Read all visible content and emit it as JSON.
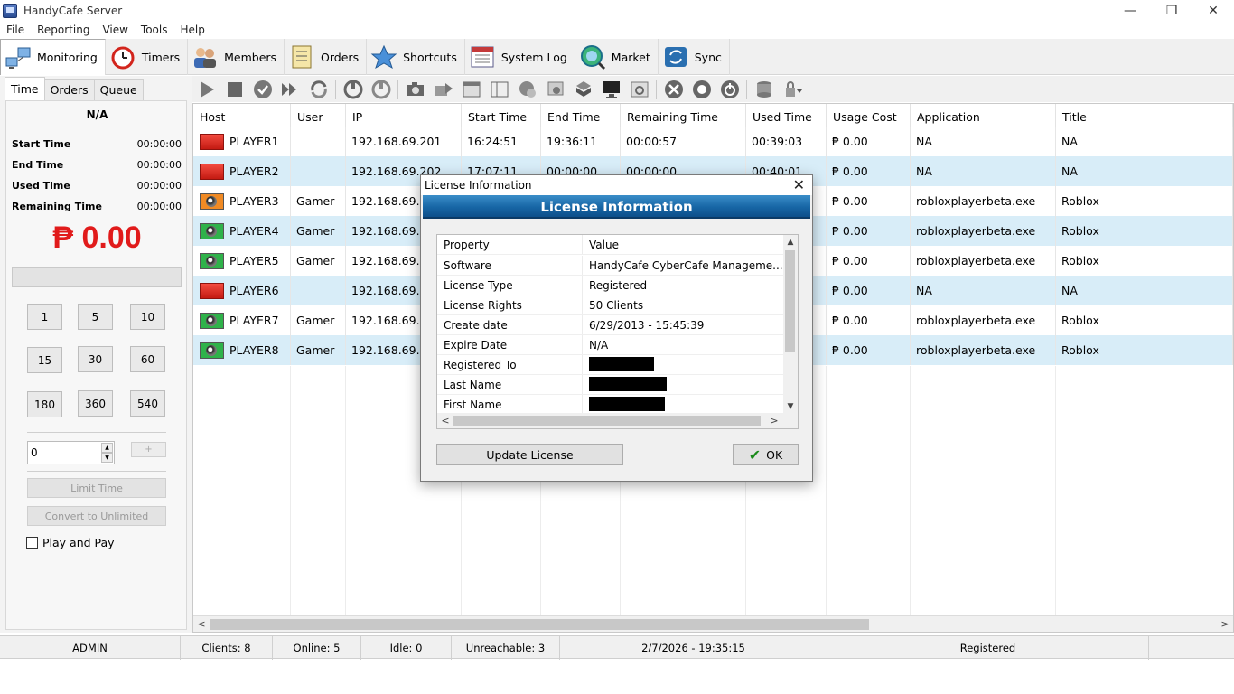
{
  "window": {
    "title": "HandyCafe Server",
    "minimize": "—",
    "restore": "❐",
    "close": "✕"
  },
  "menu": [
    "File",
    "Reporting",
    "View",
    "Tools",
    "Help"
  ],
  "main_tabs": [
    {
      "label": "Monitoring",
      "icon": "network-computers-icon"
    },
    {
      "label": "Timers",
      "icon": "alarm-clock-icon"
    },
    {
      "label": "Members",
      "icon": "users-icon"
    },
    {
      "label": "Orders",
      "icon": "order-list-icon"
    },
    {
      "label": "Shortcuts",
      "icon": "star-icon"
    },
    {
      "label": "System Log",
      "icon": "log-icon"
    },
    {
      "label": "Market",
      "icon": "globe-search-icon"
    },
    {
      "label": "Sync",
      "icon": "sync-icon"
    }
  ],
  "left": {
    "tabs": [
      "Time",
      "Orders",
      "Queue"
    ],
    "host": "N/A",
    "times": [
      {
        "label": "Start Time",
        "value": "00:00:00"
      },
      {
        "label": "End Time",
        "value": "00:00:00"
      },
      {
        "label": "Used Time",
        "value": "00:00:00"
      },
      {
        "label": "Remaining Time",
        "value": "00:00:00"
      }
    ],
    "price": "₱ 0.00",
    "presets": [
      "1",
      "5",
      "10",
      "15",
      "30",
      "60",
      "180",
      "360",
      "540"
    ],
    "spin_value": "0",
    "plus_label": "+",
    "limit_time": "Limit Time",
    "convert_unlimited": "Convert to Unlimited",
    "play_and_pay": "Play and Pay"
  },
  "grid": {
    "columns": [
      "Host",
      "User",
      "IP",
      "Start Time",
      "End Time",
      "Remaining Time",
      "Used Time",
      "Usage Cost",
      "Application",
      "Title"
    ],
    "rows": [
      {
        "host": "PLAYER1",
        "status": "red",
        "user": "",
        "ip": "192.168.69.201",
        "start": "16:24:51",
        "end": "19:36:11",
        "remaining": "00:00:57",
        "used": "00:39:03",
        "cost": "₱ 0.00",
        "app": "NA",
        "title": "NA"
      },
      {
        "host": "PLAYER2",
        "status": "red",
        "user": "",
        "ip": "192.168.69.202",
        "start": "17:07:11",
        "end": "00:00:00",
        "remaining": "00:00:00",
        "used": "00:40:01",
        "cost": "₱ 0.00",
        "app": "NA",
        "title": "NA"
      },
      {
        "host": "PLAYER3",
        "status": "orange",
        "user": "Gamer",
        "ip": "192.168.69.2",
        "start": "",
        "end": "",
        "remaining": "",
        "used": "",
        "cost": "₱ 0.00",
        "app": "robloxplayerbeta.exe",
        "title": "Roblox"
      },
      {
        "host": "PLAYER4",
        "status": "green",
        "user": "Gamer",
        "ip": "192.168.69.2",
        "start": "",
        "end": "",
        "remaining": "",
        "used": "",
        "cost": "₱ 0.00",
        "app": "robloxplayerbeta.exe",
        "title": "Roblox"
      },
      {
        "host": "PLAYER5",
        "status": "green",
        "user": "Gamer",
        "ip": "192.168.69.2",
        "start": "",
        "end": "",
        "remaining": "",
        "used": "",
        "cost": "₱ 0.00",
        "app": "robloxplayerbeta.exe",
        "title": "Roblox"
      },
      {
        "host": "PLAYER6",
        "status": "red",
        "user": "",
        "ip": "192.168.69.2",
        "start": "",
        "end": "",
        "remaining": "",
        "used": "",
        "cost": "₱ 0.00",
        "app": "NA",
        "title": "NA"
      },
      {
        "host": "PLAYER7",
        "status": "green",
        "user": "Gamer",
        "ip": "192.168.69.2",
        "start": "",
        "end": "",
        "remaining": "",
        "used": "",
        "cost": "₱ 0.00",
        "app": "robloxplayerbeta.exe",
        "title": "Roblox"
      },
      {
        "host": "PLAYER8",
        "status": "green",
        "user": "Gamer",
        "ip": "192.168.69.2",
        "start": "",
        "end": "",
        "remaining": "",
        "used": "",
        "cost": "₱ 0.00",
        "app": "robloxplayerbeta.exe",
        "title": "Roblox"
      }
    ]
  },
  "status": {
    "user": "ADMIN",
    "clients": "Clients: 8",
    "online": "Online: 5",
    "idle": "Idle: 0",
    "unreachable": "Unreachable: 3",
    "datetime": "2/7/2026 - 19:35:15",
    "license": "Registered"
  },
  "dialog": {
    "title": "License Information",
    "banner": "License Information",
    "headers": [
      "Property",
      "Value"
    ],
    "rows": [
      {
        "k": "Software",
        "v": "HandyCafe CyberCafe Manageme..."
      },
      {
        "k": "License Type",
        "v": "Registered"
      },
      {
        "k": "License Rights",
        "v": "50 Clients"
      },
      {
        "k": "Create date",
        "v": "6/29/2013 - 15:45:39"
      },
      {
        "k": "Expire Date",
        "v": "N/A"
      },
      {
        "k": "Registered To",
        "v": ""
      },
      {
        "k": "Last Name",
        "v": ""
      },
      {
        "k": "First Name",
        "v": ""
      }
    ],
    "update_label": "Update License",
    "ok_label": "OK"
  },
  "colors": {
    "red_price": "#e11b1b",
    "banner": "#1766a5",
    "row_alt": "#d8edf8"
  }
}
